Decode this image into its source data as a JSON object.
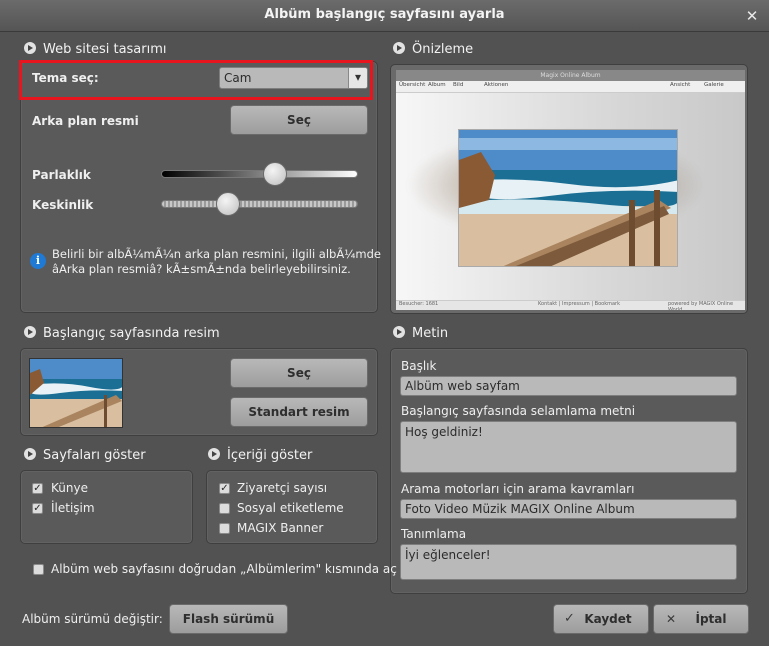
{
  "window": {
    "title": "Albüm başlangıç sayfasını ayarla",
    "close": "✕"
  },
  "web_design": {
    "header": "Web sitesi tasarımı",
    "theme_label": "Tema seç:",
    "theme_value": "Cam",
    "bg_image_label": "Arka plan resmi",
    "bg_choose": "Seç",
    "brightness_label": "Parlaklık",
    "brightness_value": 0.68,
    "sharpness_label": "Keskinlik",
    "sharpness_value": 0.3,
    "info_text_1": "Belirli bir albÃ¼mÃ¼n arka plan resmini, ilgili albÃ¼mde",
    "info_text_2": "âArka plan resmiâ? kÃ±smÃ±nda belirleyebilirsiniz."
  },
  "preview": {
    "header": "Önizleme",
    "mini_title": "Magix Online Album",
    "mini_tabs": [
      "Übersicht",
      "Album",
      "Bild"
    ],
    "mini_actions": "Aktionen",
    "mini_view_label": "Ansicht",
    "mini_view_value": "Galerie",
    "mini_footer_left": "Besucher: 1681",
    "mini_footer_mid": "Kontakt | Impressum | Bookmark",
    "mini_footer_right": "powered by MAGIX Online World"
  },
  "start_image": {
    "header": "Başlangıç sayfasında resim",
    "choose": "Seç",
    "standard": "Standart resim"
  },
  "text": {
    "header": "Metin",
    "title_label": "Başlık",
    "title_value": "Albüm web sayfam",
    "welcome_label": "Başlangıç sayfasında selamlama metni",
    "welcome_value": "Hoş geldiniz!",
    "keywords_label": "Arama motorları için arama kavramları",
    "keywords_value": "Foto Video Müzik MAGIX Online Album",
    "desc_label": "Tanımlama",
    "desc_value": "İyi eğlenceler!"
  },
  "show_pages": {
    "header": "Sayfaları göster",
    "items": [
      {
        "label": "Künye",
        "checked": true
      },
      {
        "label": "İletişim",
        "checked": true
      }
    ]
  },
  "show_content": {
    "header": "İçeriği göster",
    "items": [
      {
        "label": "Ziyaretçi sayısı",
        "checked": true
      },
      {
        "label": "Sosyal etiketleme",
        "checked": false
      },
      {
        "label": "MAGIX Banner",
        "checked": false
      }
    ]
  },
  "direct_option": {
    "label": "Albüm web sayfasını doğrudan „Albümlerim\" kısmında aç",
    "checked": false
  },
  "footer": {
    "version_label": "Albüm sürümü değiştir:",
    "flash_button": "Flash sürümü",
    "save_button": "Kaydet",
    "cancel_button": "İptal"
  },
  "colors": {
    "highlight": "#e8141e",
    "info": "#1f7ad6"
  },
  "icons": {
    "check": "✓",
    "close": "✕",
    "info": "i",
    "dropdown": "▾"
  }
}
